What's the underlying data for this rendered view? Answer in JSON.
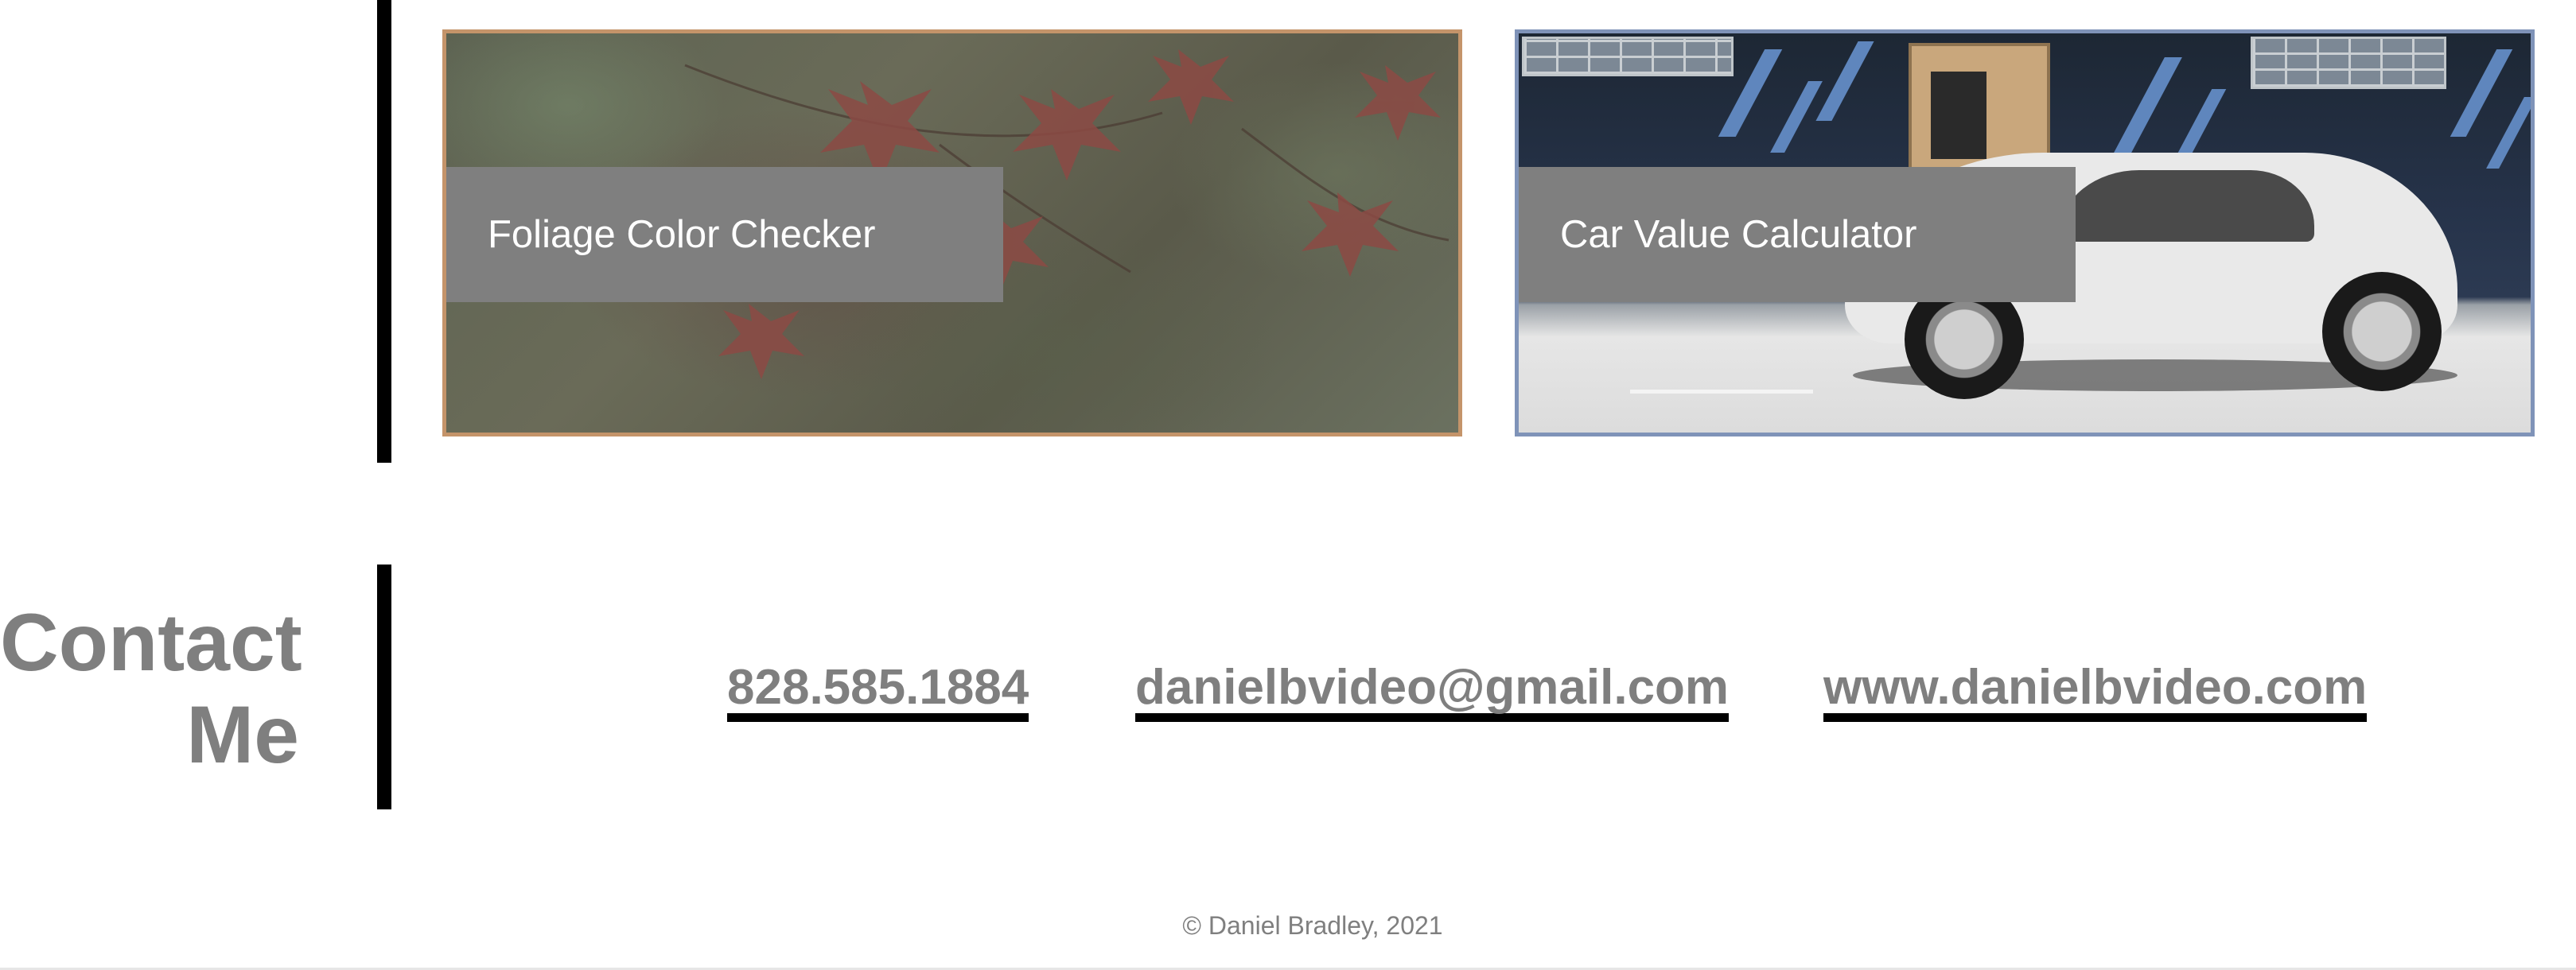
{
  "projects": {
    "cards": [
      {
        "label": "Foliage Color Checker",
        "border_color": "#c4946a"
      },
      {
        "label": "Car Value Calculator",
        "border_color": "#7f93b8"
      }
    ]
  },
  "contact": {
    "heading_line1": "Contact",
    "heading_line2": "Me",
    "phone": "828.585.1884",
    "email": "danielbvideo@gmail.com",
    "website": "www.danielbvideo.com"
  },
  "footer": {
    "copyright": "© Daniel Bradley, 2021"
  },
  "colors": {
    "text_gray": "#7f7f7f",
    "label_bg": "#7f7f7f",
    "accent_bar": "#000000"
  }
}
